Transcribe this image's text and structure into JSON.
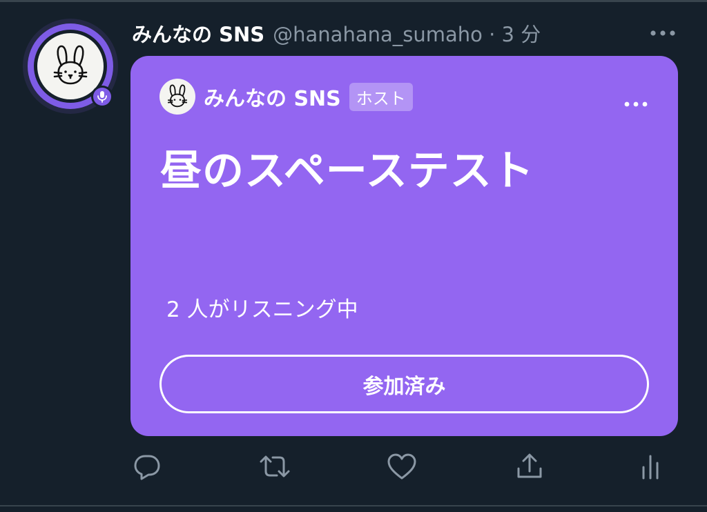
{
  "tweet": {
    "display_name": "みんなの SNS",
    "handle_time": "@hanahana_sumaho · 3 分"
  },
  "space": {
    "host_name": "みんなの SNS",
    "host_badge": "ホスト",
    "title": "昼のスペーステスト",
    "listeners": "2 人がリスニング中",
    "joined_label": "参加済み",
    "colors": {
      "card": "#9366f1",
      "avatar_ring": "#7e5ce6",
      "background": "#15202b"
    }
  },
  "icons": {
    "more": "more-horizontal-icon",
    "mic": "microphone-icon",
    "reply": "reply-icon",
    "retweet": "retweet-icon",
    "like": "heart-icon",
    "share": "share-icon",
    "views": "analytics-icon"
  }
}
